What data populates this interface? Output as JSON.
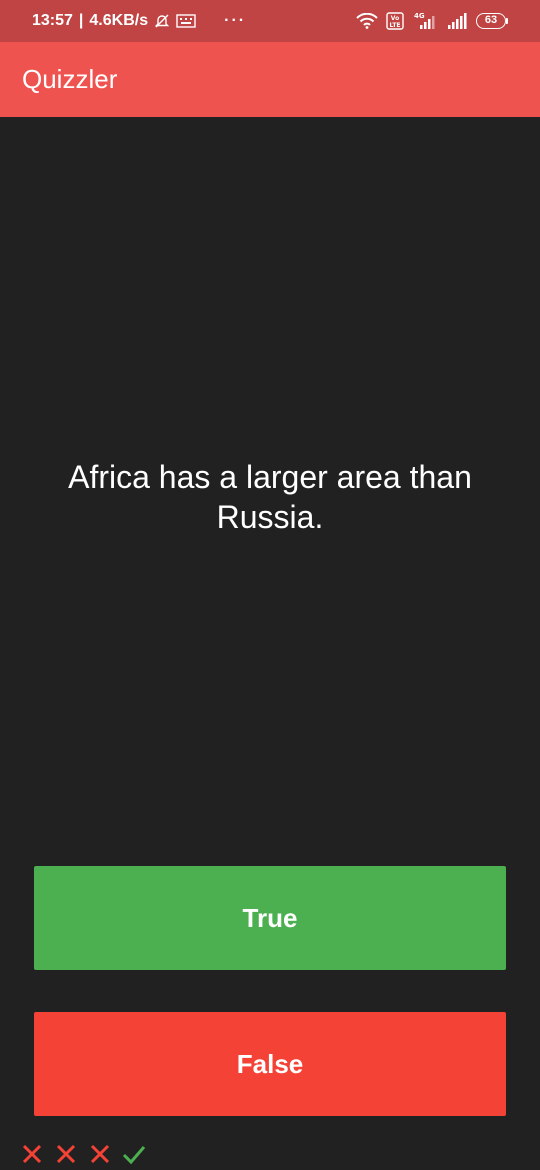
{
  "status_bar": {
    "time": "13:57",
    "separator": "|",
    "speed": "4.6KB/s",
    "more": "···",
    "network": "4G",
    "volte": "Vo LTE",
    "battery": "63"
  },
  "app_bar": {
    "title": "Quizzler",
    "color": "#ef5350"
  },
  "question": {
    "text": "Africa has a larger area than Russia."
  },
  "buttons": {
    "true_label": "True",
    "false_label": "False",
    "true_color": "#4caf50",
    "false_color": "#f44336"
  },
  "score_keeper": {
    "icons": [
      "close-icon",
      "close-icon",
      "close-icon",
      "check-icon"
    ],
    "wrong_color": "#f44336",
    "right_color": "#4caf50"
  }
}
